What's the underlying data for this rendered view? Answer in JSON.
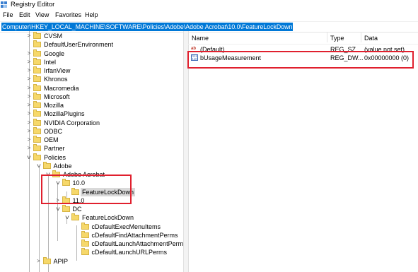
{
  "window": {
    "title": "Registry Editor"
  },
  "menu": [
    "File",
    "Edit",
    "View",
    "Favorites",
    "Help"
  ],
  "address": "Computer\\HKEY_LOCAL_MACHINE\\SOFTWARE\\Policies\\Adobe\\Adobe Acrobat\\10.0\\FeatureLockDown",
  "tree": [
    {
      "label": "CVSM",
      "expander": ">"
    },
    {
      "label": "DefaultUserEnvironment",
      "expander": ""
    },
    {
      "label": "Google",
      "expander": ">"
    },
    {
      "label": "Intel",
      "expander": ">"
    },
    {
      "label": "IrfanView",
      "expander": ">"
    },
    {
      "label": "Khronos",
      "expander": ">"
    },
    {
      "label": "Macromedia",
      "expander": ">"
    },
    {
      "label": "Microsoft",
      "expander": ">"
    },
    {
      "label": "Mozilla",
      "expander": ">"
    },
    {
      "label": "MozillaPlugins",
      "expander": ">"
    },
    {
      "label": "NVIDIA Corporation",
      "expander": ">"
    },
    {
      "label": "ODBC",
      "expander": ">"
    },
    {
      "label": "OEM",
      "expander": ">"
    },
    {
      "label": "Partner",
      "expander": ">"
    },
    {
      "label": "Policies",
      "expander": "v"
    },
    {
      "label": "Adobe",
      "expander": "v"
    },
    {
      "label": "Adobe Acrobat",
      "expander": "v"
    },
    {
      "label": "10.0",
      "expander": "v"
    },
    {
      "label": "FeatureLockDown",
      "expander": "",
      "selected": true
    },
    {
      "label": "11.0",
      "expander": ">"
    },
    {
      "label": "DC",
      "expander": "v"
    },
    {
      "label": "FeatureLockDown",
      "expander": "v"
    },
    {
      "label": "cDefaultExecMenuItems",
      "expander": ""
    },
    {
      "label": "cDefaultFindAttachmentPerms",
      "expander": ""
    },
    {
      "label": "cDefaultLaunchAttachmentPerms",
      "expander": ""
    },
    {
      "label": "cDefaultLaunchURLPerms",
      "expander": ""
    },
    {
      "label": "APIP",
      "expander": ">"
    }
  ],
  "columns": {
    "name": "Name",
    "type": "Type",
    "data": "Data"
  },
  "values": [
    {
      "name": "(Default)",
      "type": "REG_SZ",
      "data": "(value not set)",
      "icon": "string-value-icon",
      "icon_text": "ab"
    },
    {
      "name": "bUsageMeasurement",
      "type": "REG_DW...",
      "data": "0x00000000 (0)",
      "icon": "binary-value-icon",
      "icon_text": "011 110"
    }
  ],
  "colors": {
    "highlight_red": "#e0202e",
    "address_selection": "#0078d7",
    "folder": "#f6d86a"
  }
}
